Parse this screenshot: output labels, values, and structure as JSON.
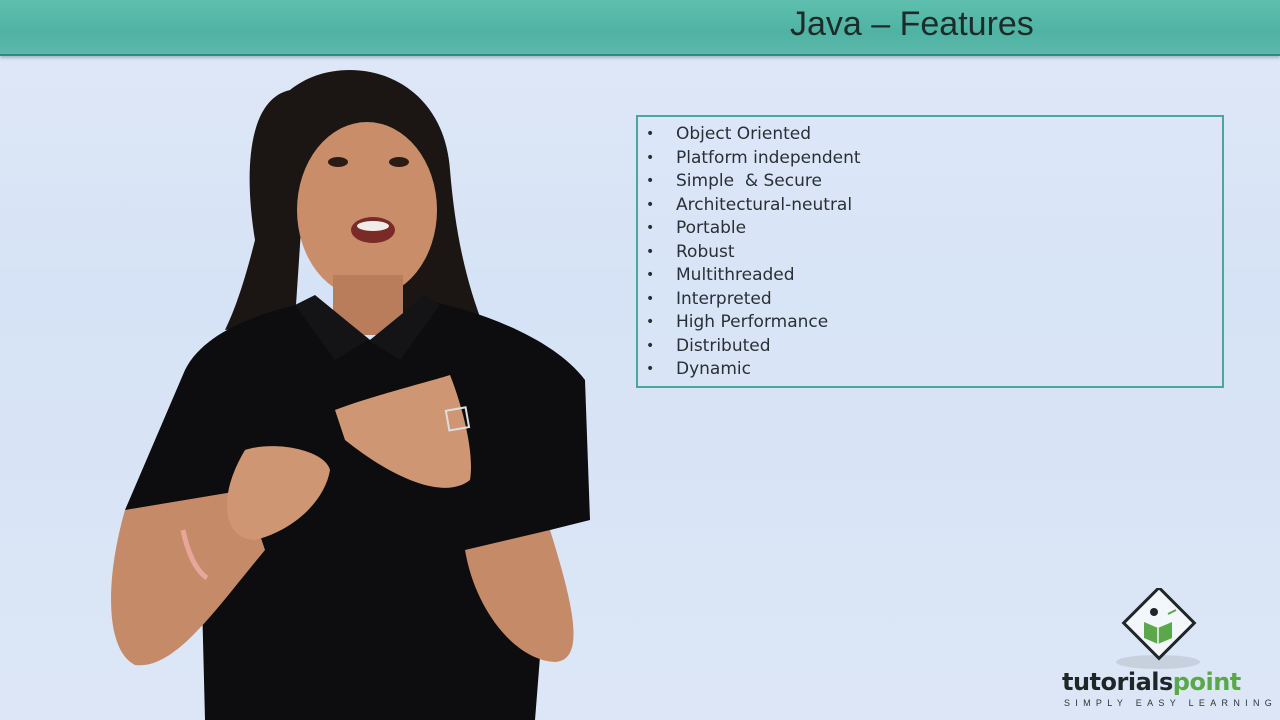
{
  "slide": {
    "title": "Java – Features",
    "features": [
      "Object Oriented",
      "Platform independent",
      "Simple  & Secure",
      "Architectural-neutral",
      "Portable",
      "Robust",
      "Multithreaded",
      "Interpreted",
      "High Performance",
      "Distributed",
      "Dynamic"
    ],
    "bullet": "•"
  },
  "logo": {
    "name_part1": "tutorials",
    "name_part2": "point",
    "tagline": "SIMPLY EASY LEARNING",
    "accent_color": "#5aa84a"
  },
  "colors": {
    "header": "#55b8a8",
    "background": "#dae5f6",
    "box_border": "#4aa79b"
  }
}
